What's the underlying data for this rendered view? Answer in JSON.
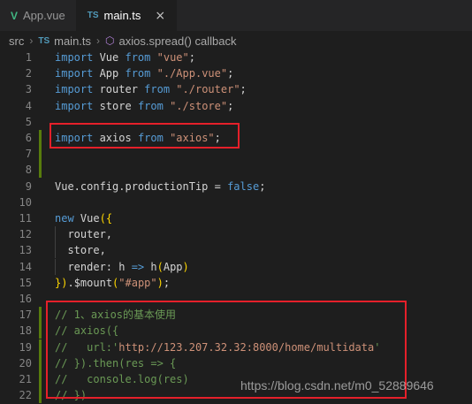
{
  "tabs": [
    {
      "icon": "V",
      "label": "App.vue",
      "active": false
    },
    {
      "icon": "TS",
      "label": "main.ts",
      "active": true,
      "close": "×"
    }
  ],
  "breadcrumb": {
    "folder": "src",
    "file_icon": "TS",
    "file": "main.ts",
    "symbol_icon": "⬡",
    "symbol": "axios.spread() callback"
  },
  "lines": [
    {
      "n": "1",
      "code": "import Vue from \"vue\";"
    },
    {
      "n": "2",
      "code": "import App from \"./App.vue\";"
    },
    {
      "n": "3",
      "code": "import router from \"./router\";"
    },
    {
      "n": "4",
      "code": "import store from \"./store\";"
    },
    {
      "n": "5",
      "code": ""
    },
    {
      "n": "6",
      "code": "import axios from \"axios\";"
    },
    {
      "n": "7",
      "code": ""
    },
    {
      "n": "8",
      "code": ""
    },
    {
      "n": "9",
      "code": "Vue.config.productionTip = false;"
    },
    {
      "n": "10",
      "code": ""
    },
    {
      "n": "11",
      "code": "new Vue({"
    },
    {
      "n": "12",
      "code": "  router,"
    },
    {
      "n": "13",
      "code": "  store,"
    },
    {
      "n": "14",
      "code": "  render: h => h(App)"
    },
    {
      "n": "15",
      "code": "}).$mount(\"#app\");"
    },
    {
      "n": "16",
      "code": ""
    },
    {
      "n": "17",
      "code": "// 1、axios的基本使用"
    },
    {
      "n": "18",
      "code": "// axios({"
    },
    {
      "n": "19",
      "code": "//   url:'http://123.207.32.32:8000/home/multidata'"
    },
    {
      "n": "20",
      "code": "// }).then(res => {"
    },
    {
      "n": "21",
      "code": "//   console.log(res)"
    },
    {
      "n": "22",
      "code": "// })"
    }
  ],
  "watermark": "https://blog.csdn.net/m0_52889646",
  "colors": {
    "keyword": "#569cd6",
    "string": "#ce9178",
    "comment": "#6a9955",
    "highlight_box": "#e5202a"
  }
}
